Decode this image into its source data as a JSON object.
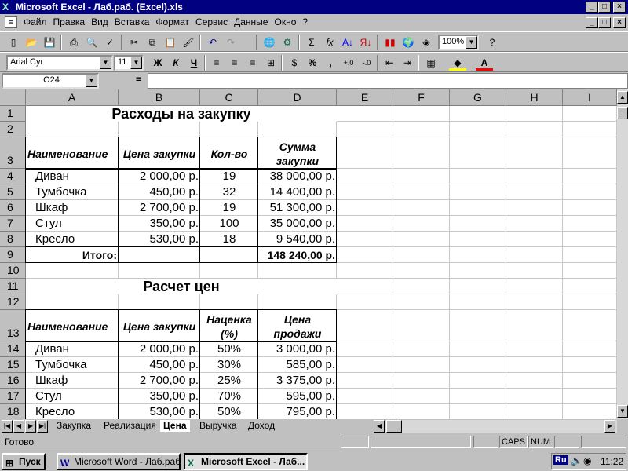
{
  "window": {
    "title": "Microsoft Excel - Лаб.раб. (Excel).xls",
    "min": "_",
    "max": "□",
    "close": "×"
  },
  "menu": [
    "Файл",
    "Правка",
    "Вид",
    "Вставка",
    "Формат",
    "Сервис",
    "Данные",
    "Окно",
    "?"
  ],
  "toolbar": {
    "zoom": "100%",
    "font": "Arial Cyr",
    "size": "11",
    "bold": "Ж",
    "italic": "К",
    "underline": "Ч",
    "percent": "%",
    "comma": ",",
    "sigma": "Σ",
    "fx": "fx"
  },
  "formula": {
    "name_box": "O24",
    "equals": "="
  },
  "columns": [
    "A",
    "B",
    "C",
    "D",
    "E",
    "F",
    "G",
    "H",
    "I"
  ],
  "rows": [
    "1",
    "2",
    "3",
    "4",
    "5",
    "6",
    "7",
    "8",
    "9",
    "10",
    "11",
    "12",
    "13",
    "14",
    "15",
    "16",
    "17",
    "18"
  ],
  "table1": {
    "title": "Расходы на закупку",
    "headers": [
      "Наименование",
      "Цена закупки",
      "Кол-во",
      "Сумма закупки"
    ],
    "rows": [
      [
        "Диван",
        "2 000,00 р.",
        "19",
        "38 000,00 р."
      ],
      [
        "Тумбочка",
        "450,00 р.",
        "32",
        "14 400,00 р."
      ],
      [
        "Шкаф",
        "2 700,00 р.",
        "19",
        "51 300,00 р."
      ],
      [
        "Стул",
        "350,00 р.",
        "100",
        "35 000,00 р."
      ],
      [
        "Кресло",
        "530,00 р.",
        "18",
        "9 540,00 р."
      ]
    ],
    "total_label": "Итого:",
    "total_value": "148 240,00 р."
  },
  "table2": {
    "title": "Расчет цен",
    "headers": [
      "Наименование",
      "Цена закупки",
      "Наценка (%)",
      "Цена продажи"
    ],
    "rows": [
      [
        "Диван",
        "2 000,00 р.",
        "50%",
        "3 000,00 р."
      ],
      [
        "Тумбочка",
        "450,00 р.",
        "30%",
        "585,00 р."
      ],
      [
        "Шкаф",
        "2 700,00 р.",
        "25%",
        "3 375,00 р."
      ],
      [
        "Стул",
        "350,00 р.",
        "70%",
        "595,00 р."
      ],
      [
        "Кресло",
        "530,00 р.",
        "50%",
        "795,00 р."
      ]
    ]
  },
  "sheets": [
    "Закупка",
    "Реализация",
    "Цена",
    "Выручка",
    "Доход"
  ],
  "active_sheet": "Цена",
  "status": {
    "ready": "Готово",
    "caps": "CAPS",
    "num": "NUM"
  },
  "taskbar": {
    "start": "Пуск",
    "word": "Microsoft Word - Лаб.раб...",
    "excel": "Microsoft Excel - Лаб...",
    "lang": "Ru",
    "clock": "11:22"
  }
}
